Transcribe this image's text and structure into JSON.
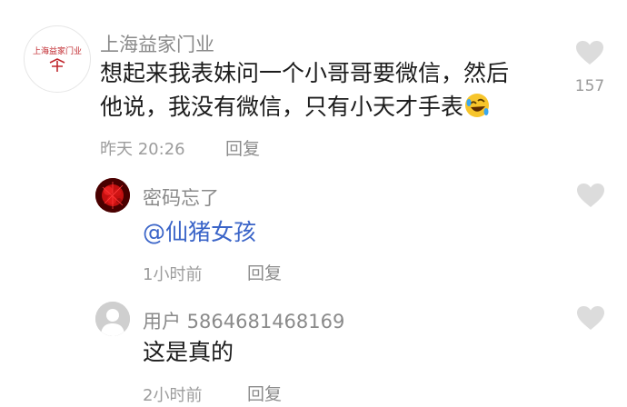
{
  "comments": [
    {
      "username": "上海益家门业",
      "avatar_text": "上海益家门业",
      "text_line1": "想起来我表妹问一个小哥哥要微信，然后",
      "text_line2": "他说，我没有微信，只有小天才手表",
      "emoji": "rolling-on-floor-laughing-emoji",
      "time": "昨天 20:26",
      "reply_label": "回复",
      "like_count": "157"
    },
    {
      "username": "密码忘了",
      "text": "@仙猪女孩",
      "time": "1小时前",
      "reply_label": "回复"
    },
    {
      "username": "用户 5864681468169",
      "text": "这是真的",
      "time": "2小时前",
      "reply_label": "回复"
    }
  ],
  "icons": {
    "like": "heart-icon",
    "default_avatar": "user-silhouette-icon"
  },
  "colors": {
    "mention": "#3a64c8",
    "heart": "#dcdcdc",
    "avatar_red": "#c41010"
  }
}
